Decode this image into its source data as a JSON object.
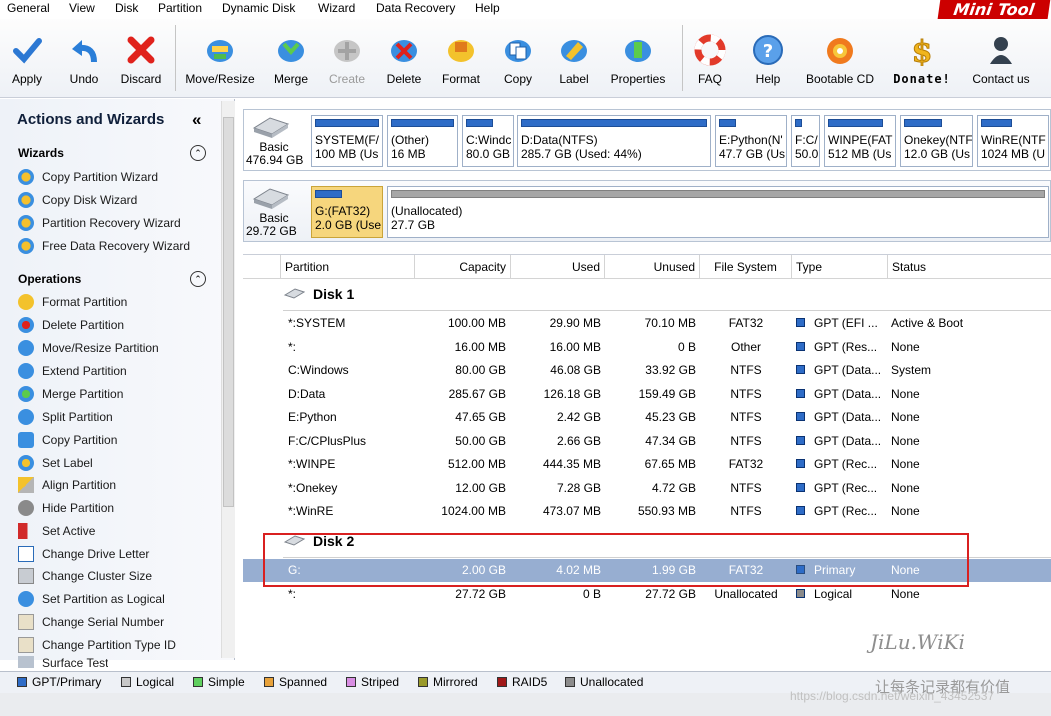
{
  "menu": [
    "General",
    "View",
    "Disk",
    "Partition",
    "Dynamic Disk",
    "Wizard",
    "Data Recovery",
    "Help"
  ],
  "logo": {
    "part1": "Mini",
    "part2": "Tool"
  },
  "toolbar": [
    {
      "label": "Apply",
      "enabled": true
    },
    {
      "label": "Undo",
      "enabled": true
    },
    {
      "label": "Discard",
      "enabled": true
    },
    {
      "label": "Move/Resize",
      "enabled": true
    },
    {
      "label": "Merge",
      "enabled": true
    },
    {
      "label": "Create",
      "enabled": false
    },
    {
      "label": "Delete",
      "enabled": true
    },
    {
      "label": "Format",
      "enabled": true
    },
    {
      "label": "Copy",
      "enabled": true
    },
    {
      "label": "Label",
      "enabled": true
    },
    {
      "label": "Properties",
      "enabled": true
    },
    {
      "label": "FAQ",
      "enabled": true
    },
    {
      "label": "Help",
      "enabled": true
    },
    {
      "label": "Bootable CD",
      "enabled": true
    },
    {
      "label": "Donate!",
      "enabled": true
    },
    {
      "label": "Contact us",
      "enabled": true
    }
  ],
  "sidebar": {
    "title": "Actions and Wizards",
    "collapse_glyph": "«",
    "wizards_title": "Wizards",
    "wizards": [
      "Copy Partition Wizard",
      "Copy Disk Wizard",
      "Partition Recovery Wizard",
      "Free Data Recovery Wizard"
    ],
    "operations_title": "Operations",
    "operations": [
      "Format Partition",
      "Delete Partition",
      "Move/Resize Partition",
      "Extend Partition",
      "Merge Partition",
      "Split Partition",
      "Copy Partition",
      "Set Label",
      "Align Partition",
      "Hide Partition",
      "Set Active",
      "Change Drive Letter",
      "Change Cluster Size",
      "Set Partition as Logical",
      "Change Serial Number",
      "Change Partition Type ID",
      "Surface Test"
    ]
  },
  "diskmap": {
    "disk1": {
      "type": "Basic",
      "size": "476.94 GB"
    },
    "disk1_parts": [
      {
        "name": "SYSTEM(F/",
        "info": "100 MB (Us"
      },
      {
        "name": "(Other)",
        "info": "16 MB"
      },
      {
        "name": "C:Windc",
        "info": "80.0 GB"
      },
      {
        "name": "D:Data(NTFS)",
        "info": "285.7 GB (Used: 44%)"
      },
      {
        "name": "E:Python(N'",
        "info": "47.7 GB (Us"
      },
      {
        "name": "F:C/",
        "info": "50.0"
      },
      {
        "name": "WINPE(FAT",
        "info": "512 MB (Us"
      },
      {
        "name": "Onekey(NTF",
        "info": "12.0 GB (Us"
      },
      {
        "name": "WinRE(NTF",
        "info": "1024 MB (U"
      }
    ],
    "disk2": {
      "type": "Basic",
      "size": "29.72 GB"
    },
    "disk2_parts": [
      {
        "name": "G:(FAT32)",
        "info": "2.0 GB (Use"
      },
      {
        "name": "(Unallocated)",
        "info": "27.7 GB"
      }
    ]
  },
  "table": {
    "columns": [
      "Partition",
      "Capacity",
      "Used",
      "Unused",
      "File System",
      "Type",
      "Status"
    ],
    "disk1_label": "Disk 1",
    "disk2_label": "Disk 2",
    "disk1_rows": [
      {
        "partition": "*:SYSTEM",
        "capacity": "100.00 MB",
        "used": "29.90 MB",
        "unused": "70.10 MB",
        "fs": "FAT32",
        "type": "GPT (EFI ...",
        "status": "Active & Boot",
        "swatch": "#2e6cc7"
      },
      {
        "partition": "*:",
        "capacity": "16.00 MB",
        "used": "16.00 MB",
        "unused": "0 B",
        "fs": "Other",
        "type": "GPT (Res...",
        "status": "None",
        "swatch": "#2e6cc7"
      },
      {
        "partition": "C:Windows",
        "capacity": "80.00 GB",
        "used": "46.08 GB",
        "unused": "33.92 GB",
        "fs": "NTFS",
        "type": "GPT (Data...",
        "status": "System",
        "swatch": "#2e6cc7"
      },
      {
        "partition": "D:Data",
        "capacity": "285.67 GB",
        "used": "126.18 GB",
        "unused": "159.49 GB",
        "fs": "NTFS",
        "type": "GPT (Data...",
        "status": "None",
        "swatch": "#2e6cc7"
      },
      {
        "partition": "E:Python",
        "capacity": "47.65 GB",
        "used": "2.42 GB",
        "unused": "45.23 GB",
        "fs": "NTFS",
        "type": "GPT (Data...",
        "status": "None",
        "swatch": "#2e6cc7"
      },
      {
        "partition": "F:C/CPlusPlus",
        "capacity": "50.00 GB",
        "used": "2.66 GB",
        "unused": "47.34 GB",
        "fs": "NTFS",
        "type": "GPT (Data...",
        "status": "None",
        "swatch": "#2e6cc7"
      },
      {
        "partition": "*:WINPE",
        "capacity": "512.00 MB",
        "used": "444.35 MB",
        "unused": "67.65 MB",
        "fs": "FAT32",
        "type": "GPT (Rec...",
        "status": "None",
        "swatch": "#2e6cc7"
      },
      {
        "partition": "*:Onekey",
        "capacity": "12.00 GB",
        "used": "7.28 GB",
        "unused": "4.72 GB",
        "fs": "NTFS",
        "type": "GPT (Rec...",
        "status": "None",
        "swatch": "#2e6cc7"
      },
      {
        "partition": "*:WinRE",
        "capacity": "1024.00 MB",
        "used": "473.07 MB",
        "unused": "550.93 MB",
        "fs": "NTFS",
        "type": "GPT (Rec...",
        "status": "None",
        "swatch": "#2e6cc7"
      }
    ],
    "disk2_rows": [
      {
        "partition": "G:",
        "capacity": "2.00 GB",
        "used": "4.02 MB",
        "unused": "1.99 GB",
        "fs": "FAT32",
        "type": "Primary",
        "status": "None",
        "swatch": "#2e6cc7",
        "selected": true
      },
      {
        "partition": "*:",
        "capacity": "27.72 GB",
        "used": "0 B",
        "unused": "27.72 GB",
        "fs": "Unallocated",
        "type": "Logical",
        "status": "None",
        "swatch": "#8a8a8a",
        "selected": false
      }
    ]
  },
  "legend": [
    {
      "label": "GPT/Primary",
      "color": "#2e6cc7"
    },
    {
      "label": "Logical",
      "color": "#c8c8c8"
    },
    {
      "label": "Simple",
      "color": "#5fd05f"
    },
    {
      "label": "Spanned",
      "color": "#e8a23a"
    },
    {
      "label": "Striped",
      "color": "#d98ee3"
    },
    {
      "label": "Mirrored",
      "color": "#9a9a2a"
    },
    {
      "label": "RAID5",
      "color": "#a01818"
    },
    {
      "label": "Unallocated",
      "color": "#8c8c8c"
    }
  ],
  "watermark": {
    "brand": "JiLu.WiKi",
    "slogan": "让每条记录都有价值",
    "url": "https://blog.csdn.net/weixin_43452537"
  }
}
